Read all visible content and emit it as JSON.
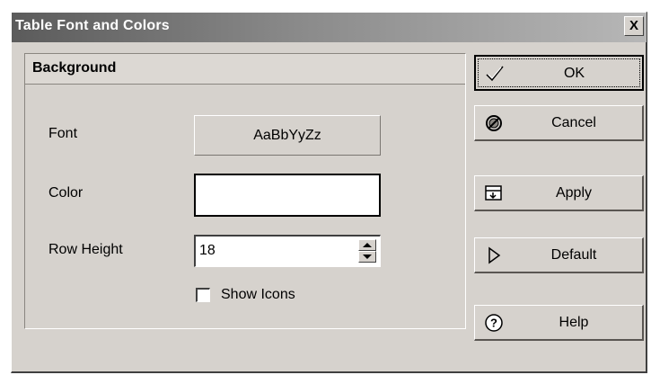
{
  "window": {
    "title": "Table Font and Colors",
    "close_label": "X"
  },
  "panel": {
    "header": "Background",
    "font_label": "Font",
    "font_sample": "AaBbYyZz",
    "color_label": "Color",
    "color_value": "#ffffff",
    "row_height_label": "Row Height",
    "row_height_value": "18",
    "show_icons_label": "Show Icons",
    "show_icons_checked": false
  },
  "buttons": {
    "ok": {
      "label": "OK",
      "icon": "checkmark-icon"
    },
    "cancel": {
      "label": "Cancel",
      "icon": "cancel-circle-icon"
    },
    "apply": {
      "label": "Apply",
      "icon": "apply-icon"
    },
    "default": {
      "label": "Default",
      "icon": "play-triangle-icon"
    },
    "help": {
      "label": "Help",
      "icon": "help-circle-icon"
    }
  }
}
